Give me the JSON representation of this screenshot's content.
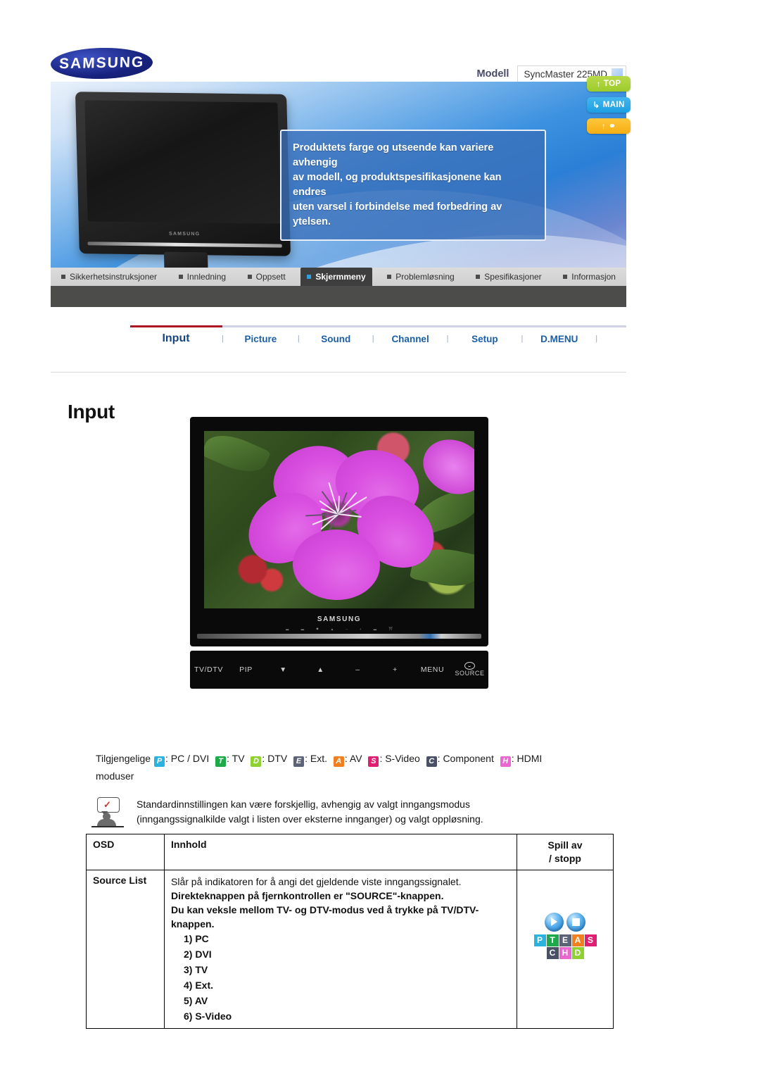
{
  "brand": {
    "logo_text": "SAMSUNG"
  },
  "header": {
    "model_label": "Modell",
    "model_value": "SyncMaster 225MD"
  },
  "banner": {
    "notice_lines": [
      "Produktets farge og utseende kan variere avhengig",
      "av modell, og produktspesifikasjonene kan endres",
      "uten varsel i forbindelse med forbedring av ytelsen."
    ]
  },
  "side_buttons": [
    {
      "label": "TOP",
      "icon": "up-arrow-icon",
      "color": "#9ccb2c"
    },
    {
      "label": "MAIN",
      "icon": "return-arrow-icon",
      "color": "#1c9fe2"
    },
    {
      "label": "",
      "icon": "up-arrow-book-icon",
      "color": "#f5ae12"
    }
  ],
  "nav_tabs": [
    {
      "label": "Sikkerhetsinstruksjoner",
      "active": false
    },
    {
      "label": "Innledning",
      "active": false
    },
    {
      "label": "Oppsett",
      "active": false
    },
    {
      "label": "Skjermmeny",
      "active": true
    },
    {
      "label": "Problemløsning",
      "active": false
    },
    {
      "label": "Spesifikasjoner",
      "active": false
    },
    {
      "label": "Informasjon",
      "active": false
    }
  ],
  "submenu": {
    "items": [
      "Input",
      "Picture",
      "Sound",
      "Channel",
      "Setup",
      "D.MENU"
    ],
    "selected": "Input"
  },
  "page_title": "Input",
  "device_photo": {
    "screen_content": "purple-flower-photo",
    "brand_text": "SAMSUNG",
    "control_panel_keys": [
      "TV/DTV",
      "PIP",
      "▼",
      "▲",
      "–",
      "+",
      "MENU"
    ],
    "source_key_label": "SOURCE"
  },
  "legend": {
    "prefix": "Tilgjengelige",
    "suffix": "moduser",
    "items": [
      {
        "code": "P",
        "text": ": PC / DVI",
        "color": "#2bb3e0"
      },
      {
        "code": "T",
        "text": ": TV",
        "color": "#1eaa4b"
      },
      {
        "code": "D",
        "text": ": DTV",
        "color": "#8ed130"
      },
      {
        "code": "E",
        "text": ": Ext.",
        "color": "#5c6379"
      },
      {
        "code": "A",
        "text": ": AV",
        "color": "#f07f20"
      },
      {
        "code": "S",
        "text": ": S-Video",
        "color": "#e01f72"
      },
      {
        "code": "C",
        "text": ": Component",
        "color": "#4a5167"
      },
      {
        "code": "H",
        "text": ": HDMI",
        "color": "#ea66d0"
      }
    ]
  },
  "note": {
    "icon": "tip-person-icon",
    "lines": [
      "Standardinnstillingen kan være forskjellig, avhengig av valgt inngangsmodus",
      "(inngangssignalkilde valgt i listen over eksterne innganger) og valgt oppløsning."
    ]
  },
  "table": {
    "headers": {
      "osd": "OSD",
      "innhold": "Innhold",
      "play_line1": "Spill av",
      "play_line2": "/ stopp"
    },
    "rows": [
      {
        "osd": "Source List",
        "desc": "Slår på indikatoren for å angi det gjeldende viste inngangssignalet.",
        "bold_lines": [
          "Direkteknappen på fjernkontrollen er \"SOURCE\"-knappen.",
          "Du kan veksle mellom TV- og DTV-modus ved å trykke på TV/DTV-",
          "knappen."
        ],
        "options": [
          "1) PC",
          "2) DVI",
          "3) TV",
          "4) Ext.",
          "5) AV",
          "6) S-Video"
        ],
        "play_badges_row1": [
          {
            "code": "P",
            "color": "#2bb3e0"
          },
          {
            "code": "T",
            "color": "#1eaa4b"
          },
          {
            "code": "E",
            "color": "#5c6379"
          },
          {
            "code": "A",
            "color": "#f07f20"
          },
          {
            "code": "S",
            "color": "#e01f72"
          }
        ],
        "play_badges_row2": [
          {
            "code": "C",
            "color": "#4a5167"
          },
          {
            "code": "H",
            "color": "#ea66d0"
          },
          {
            "code": "D",
            "color": "#8ed130"
          }
        ]
      }
    ]
  }
}
